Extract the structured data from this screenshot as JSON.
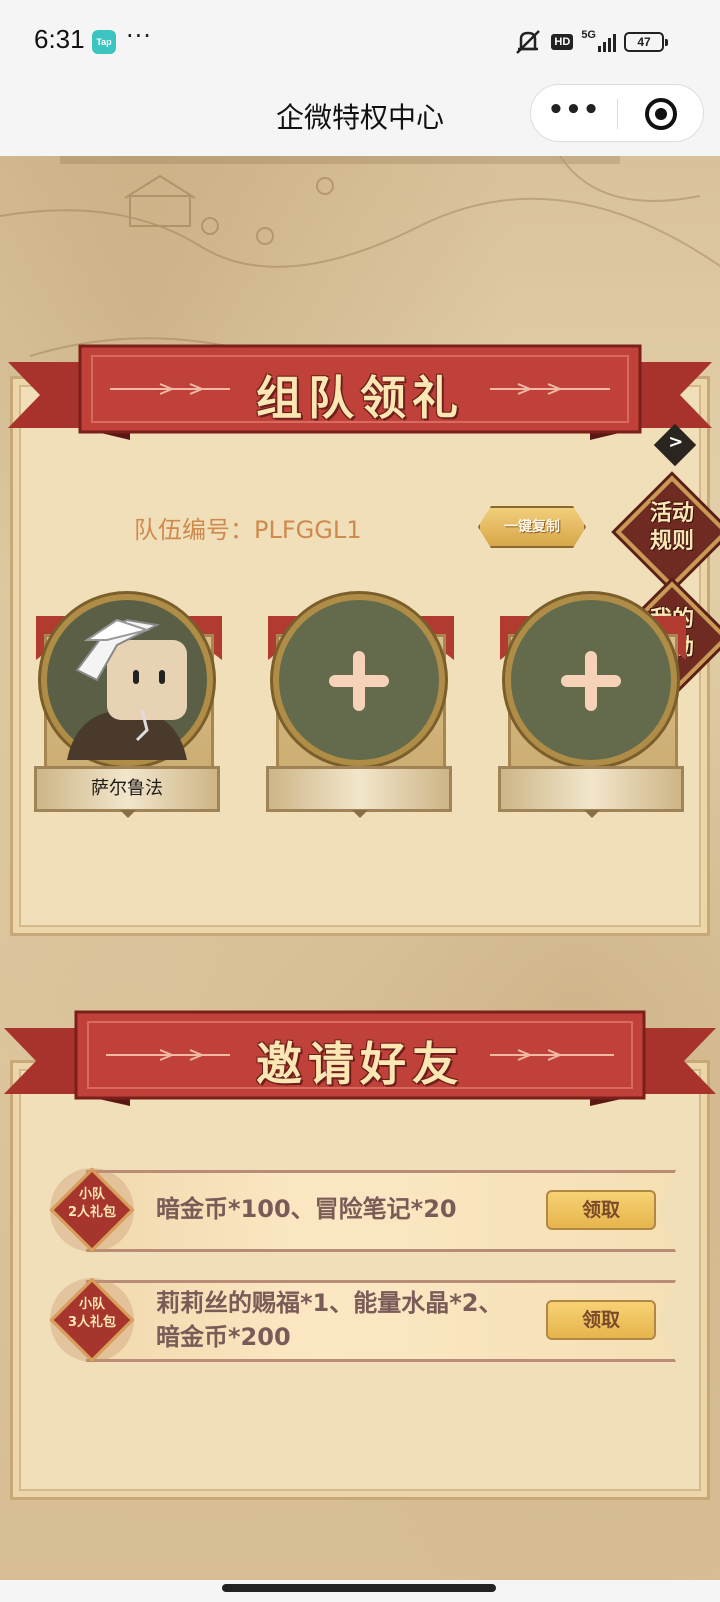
{
  "status_bar": {
    "time": "6:31",
    "app_badge": "Tap",
    "more_dots": "···",
    "hd": "HD",
    "network": "5G",
    "battery": "47"
  },
  "header": {
    "title": "企微特权中心",
    "menu_dots": "•••"
  },
  "team_section": {
    "title": "组队领礼",
    "team_id_label": "队伍编号：PLFGGL1",
    "copy_button": "一键复制",
    "rules_button": "活动\n规则",
    "my_rewards_button": "我的\n奖励",
    "members": [
      {
        "name": "萨尔鲁法",
        "filled": true
      },
      {
        "name": "",
        "filled": false
      },
      {
        "name": "",
        "filled": false
      }
    ]
  },
  "invite_section": {
    "title": "邀请好友",
    "rewards": [
      {
        "badge": "小队\n2人礼包",
        "description": "暗金币*100、冒险笔记*20",
        "button": "领取"
      },
      {
        "badge": "小队\n3人礼包",
        "description": "莉莉丝的赐福*1、能量水晶*2、\n暗金币*200",
        "button": "领取"
      }
    ]
  },
  "icons": [
    "mute-icon",
    "signal-icon",
    "battery-icon",
    "more-icon",
    "close-miniprogram-icon",
    "plus-icon",
    "chevron-right-icon"
  ],
  "colors": {
    "ribbon": "#c0403a",
    "panel": "#f0dfb8",
    "team_id_text": "#cf8a4e",
    "claim_button": "#eec061"
  }
}
